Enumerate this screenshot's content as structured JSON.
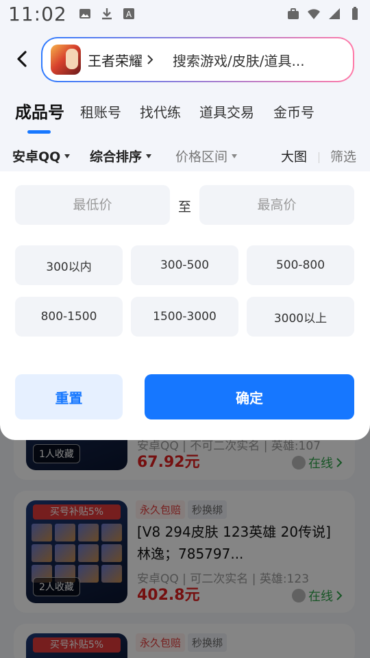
{
  "status_bar": {
    "time": "11:02"
  },
  "header": {
    "game_name": "王者荣耀",
    "search_placeholder": "搜索游戏/皮肤/道具..."
  },
  "tabs": [
    {
      "label": "成品号",
      "active": true
    },
    {
      "label": "租账号"
    },
    {
      "label": "找代练"
    },
    {
      "label": "道具交易"
    },
    {
      "label": "金币号"
    }
  ],
  "filters": {
    "platform": "安卓QQ",
    "sort": "综合排序",
    "price_range": "价格区间",
    "view": "大图",
    "filter": "筛选"
  },
  "price_panel": {
    "min_placeholder": "最低价",
    "to": "至",
    "max_placeholder": "最高价",
    "ranges": [
      "300以内",
      "300-500",
      "500-800",
      "800-1500",
      "1500-3000",
      "3000以上"
    ],
    "reset": "重置",
    "confirm": "确定"
  },
  "listings": [
    {
      "fav": "1人收藏",
      "meta": "安卓QQ | 不可二次实名 | 英雄:107",
      "price": "67.92元",
      "online": "在线"
    },
    {
      "ribbon": "买号补贴5%",
      "tag1": "永久包赔",
      "tag2": "秒换绑",
      "title": "[V8 294皮肤 123英雄 20传说] 林逸；785797...",
      "fav": "2人收藏",
      "meta": "安卓QQ | 可二次实名 | 英雄:123",
      "price": "402.8元",
      "online": "在线"
    },
    {
      "ribbon": "买号补贴5%",
      "tag1": "永久包赔",
      "tag2": "秒换绑"
    }
  ],
  "colors": {
    "accent": "#1677ff",
    "price": "#e02020",
    "online": "#2fa44a"
  }
}
